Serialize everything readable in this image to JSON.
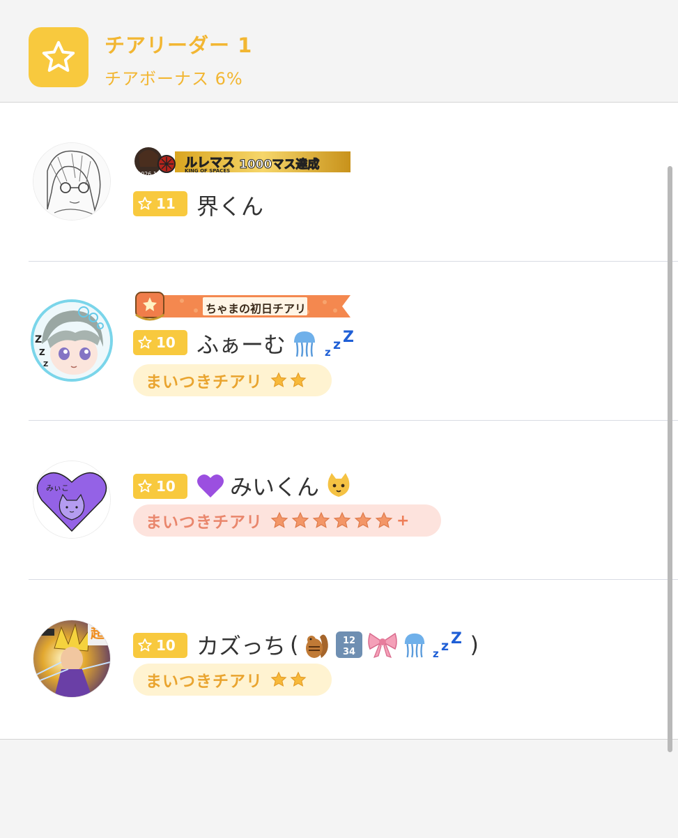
{
  "header": {
    "icon": "star-icon",
    "title": "チアリーダー 1",
    "subtitle": "チアボーナス 6%"
  },
  "rows": [
    {
      "banner_text": "ルレマス",
      "banner_text2": "1000マス達成",
      "banner_sub": "KING OF SPACES",
      "banner_year": "2026.1",
      "level": "11",
      "name": "界くん"
    },
    {
      "banner_text": "ちゃまの初日チアリ",
      "level": "10",
      "name": "ふぁーむ",
      "name_emoji": [
        "jellyfish-icon",
        "zzz-icon"
      ],
      "cheer_label": "まいつきチアリ",
      "cheer_stars": 2
    },
    {
      "level": "10",
      "name": "みいくん",
      "name_emoji": [
        "purple-heart-icon",
        "cat-face-icon"
      ],
      "avatar_text": "みぃこ",
      "cheer_label": "まいつきチアリ",
      "cheer_stars": 6,
      "cheer_plus": "+"
    },
    {
      "level": "10",
      "name": "カズっち",
      "name_paren_open": "(",
      "name_paren_close": ")",
      "name_emoji": [
        "chipmunk-icon",
        "numbers-1234-icon",
        "ribbon-icon",
        "jellyfish-icon",
        "zzz-icon"
      ],
      "avatar_text": "超",
      "cheer_label": "まいつきチアリ",
      "cheer_stars": 2
    }
  ],
  "colors": {
    "accent": "#f8c93e",
    "accent_text": "#f2b632",
    "pill_yellow_bg": "#fff3d1",
    "pill_pink_bg": "#fde3dd",
    "zzz_blue": "#1f5fd6"
  }
}
